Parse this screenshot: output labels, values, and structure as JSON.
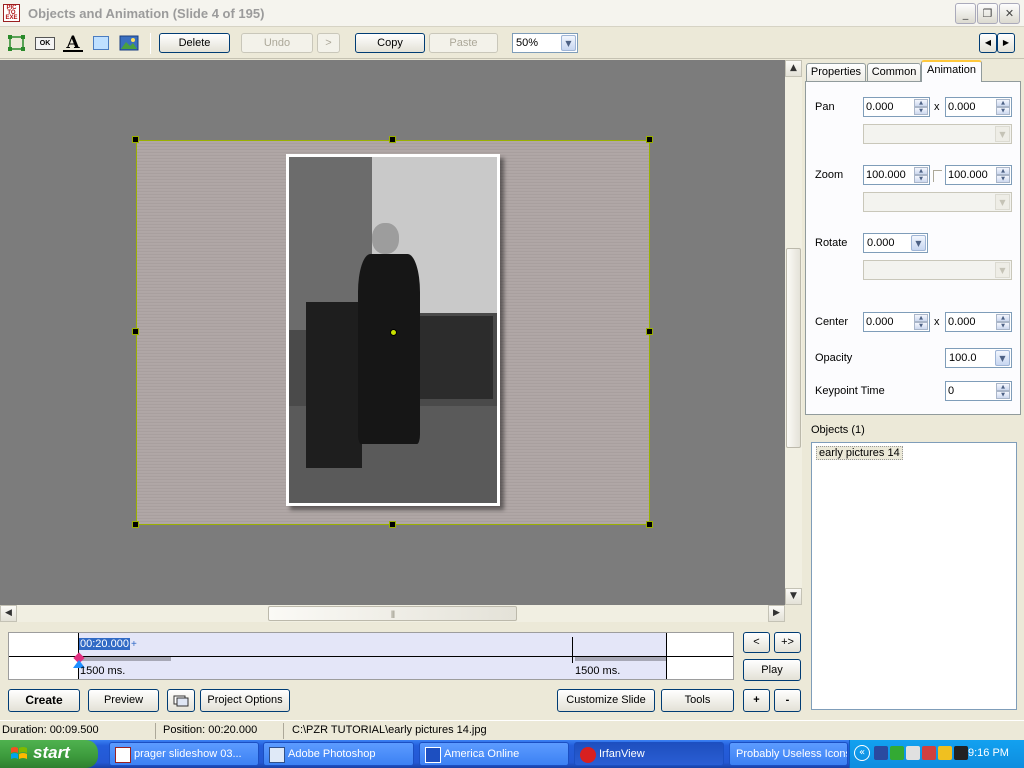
{
  "window": {
    "title": "Objects and Animation  (Slide 4 of 195)",
    "app_icon_text": "PIC TO EXE",
    "minimize_glyph": "_",
    "restore_glyph": "❐",
    "close_glyph": "✕"
  },
  "toolbar": {
    "tools": [
      "rectangle-select",
      "button",
      "text",
      "frame",
      "image"
    ],
    "button_label": "OK",
    "text_glyph": "A",
    "delete_label": "Delete",
    "undo_label": "Undo",
    "redo_label": ">",
    "copy_label": "Copy",
    "paste_label": "Paste",
    "zoom_value": "50%",
    "nav_prev": "◀",
    "nav_next": "▶"
  },
  "tabs": {
    "properties": "Properties",
    "common": "Common",
    "animation": "Animation",
    "active": "Animation"
  },
  "animation": {
    "pan_label": "Pan",
    "pan_x": "0.000",
    "pan_y": "0.000",
    "zoom_label": "Zoom",
    "zoom_x": "100.000",
    "zoom_y": "100.000",
    "rotate_label": "Rotate",
    "rotate_value": "0.000",
    "center_label": "Center",
    "center_x": "0.000",
    "center_y": "0.000",
    "opacity_label": "Opacity",
    "opacity_value": "100.0",
    "keypoint_label": "Keypoint Time",
    "keypoint_value": "0",
    "x_sep": "x"
  },
  "objects": {
    "label": "Objects (1)",
    "items": [
      "early pictures 14"
    ]
  },
  "timeline": {
    "current_time": "00:20.000",
    "plus": "+",
    "left_ms": "1500 ms.",
    "right_ms": "1500 ms."
  },
  "timeline_buttons": {
    "prev": "<",
    "next": "+>",
    "play": "Play"
  },
  "bottom_buttons": {
    "create": "Create",
    "preview": "Preview",
    "project_options": "Project Options",
    "customize_slide": "Customize Slide",
    "tools": "Tools",
    "add": "+",
    "remove": "-"
  },
  "status": {
    "duration": "Duration:  00:09.500",
    "position": "Position:  00:20.000",
    "file_path": "C:\\PZR TUTORIAL\\early pictures 14.jpg"
  },
  "taskbar": {
    "start_label": "start",
    "tasks": [
      {
        "label": "prager slideshow 03...",
        "icon": "pte-icon"
      },
      {
        "label": "Adobe Photoshop",
        "icon": "photoshop-icon"
      },
      {
        "label": "America  Online",
        "icon": "aol-icon"
      },
      {
        "label": "IrfanView",
        "icon": "irfanview-icon"
      },
      {
        "label": "Probably Useless Icons",
        "icon": "none"
      }
    ],
    "tray_expand": "«",
    "clock": "9:16 PM"
  },
  "colors": {
    "selection_frame": "#9ab000",
    "canvas_bg": "#7c7c7c",
    "timeline_highlight": "#316ac5",
    "keyframe": "#e03080"
  }
}
